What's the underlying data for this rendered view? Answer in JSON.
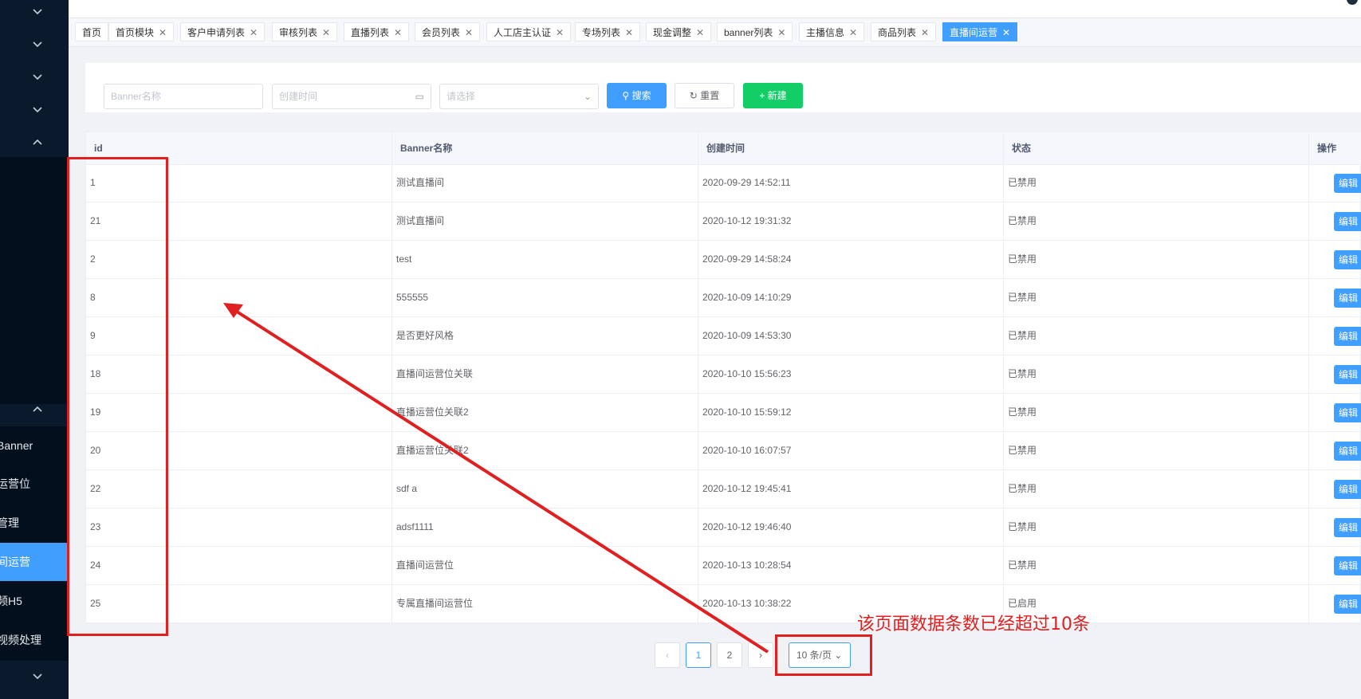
{
  "sidebar": {
    "items": [
      {
        "label": "Banner"
      },
      {
        "label": "运营位"
      },
      {
        "label": "管理"
      },
      {
        "label": "间运营"
      },
      {
        "label": "频H5"
      },
      {
        "label": "视频处理"
      }
    ],
    "active_index": 3
  },
  "tags": [
    {
      "label": "首页",
      "closable": false
    },
    {
      "label": "首页模块",
      "closable": true
    },
    {
      "label": "客户申请列表",
      "closable": true
    },
    {
      "label": "审核列表",
      "closable": true
    },
    {
      "label": "直播列表",
      "closable": true
    },
    {
      "label": "会员列表",
      "closable": true
    },
    {
      "label": "人工店主认证",
      "closable": true
    },
    {
      "label": "专场列表",
      "closable": true
    },
    {
      "label": "现金调整",
      "closable": true
    },
    {
      "label": "banner列表",
      "closable": true
    },
    {
      "label": "主播信息",
      "closable": true
    },
    {
      "label": "商品列表",
      "closable": true
    },
    {
      "label": "直播间运营",
      "closable": true,
      "active": true
    }
  ],
  "search": {
    "name_placeholder": "Banner名称",
    "date_placeholder": "创建时间",
    "select_placeholder": "请选择",
    "search_label": "搜索",
    "reset_label": "重置",
    "new_label": "新建"
  },
  "table": {
    "columns": [
      "id",
      "Banner名称",
      "创建时间",
      "状态",
      "操作"
    ],
    "action_label": "编辑",
    "rows": [
      {
        "id": "1",
        "name": "测试直播间",
        "created": "2020-09-29 14:52:11",
        "status": "已禁用"
      },
      {
        "id": "21",
        "name": "测试直播间",
        "created": "2020-10-12 19:31:32",
        "status": "已禁用"
      },
      {
        "id": "2",
        "name": "test",
        "created": "2020-09-29 14:58:24",
        "status": "已禁用"
      },
      {
        "id": "8",
        "name": "555555",
        "created": "2020-10-09 14:10:29",
        "status": "已禁用"
      },
      {
        "id": "9",
        "name": "是否更好风格",
        "created": "2020-10-09 14:53:30",
        "status": "已禁用"
      },
      {
        "id": "18",
        "name": "直播间运营位关联",
        "created": "2020-10-10 15:56:23",
        "status": "已禁用"
      },
      {
        "id": "19",
        "name": "直播运营位关联2",
        "created": "2020-10-10 15:59:12",
        "status": "已禁用"
      },
      {
        "id": "20",
        "name": "直播运营位关联2",
        "created": "2020-10-10 16:07:57",
        "status": "已禁用"
      },
      {
        "id": "22",
        "name": "sdf a",
        "created": "2020-10-12 19:45:41",
        "status": "已禁用"
      },
      {
        "id": "23",
        "name": "adsf1111",
        "created": "2020-10-12 19:46:40",
        "status": "已禁用"
      },
      {
        "id": "24",
        "name": "直播间运营位",
        "created": "2020-10-13 10:28:54",
        "status": "已禁用"
      },
      {
        "id": "25",
        "name": "专属直播间运营位",
        "created": "2020-10-13 10:38:22",
        "status": "已启用"
      }
    ]
  },
  "pagination": {
    "prev": "‹",
    "pages": [
      "1",
      "2"
    ],
    "current": "1",
    "next": "›",
    "page_size": "10 条/页"
  },
  "annotation": {
    "text": "该页面数据条数已经超过10条",
    "color": "#e02020"
  },
  "colors": {
    "primary": "#409eff",
    "success": "#13ce66",
    "sidebar": "#0a1a2c"
  }
}
